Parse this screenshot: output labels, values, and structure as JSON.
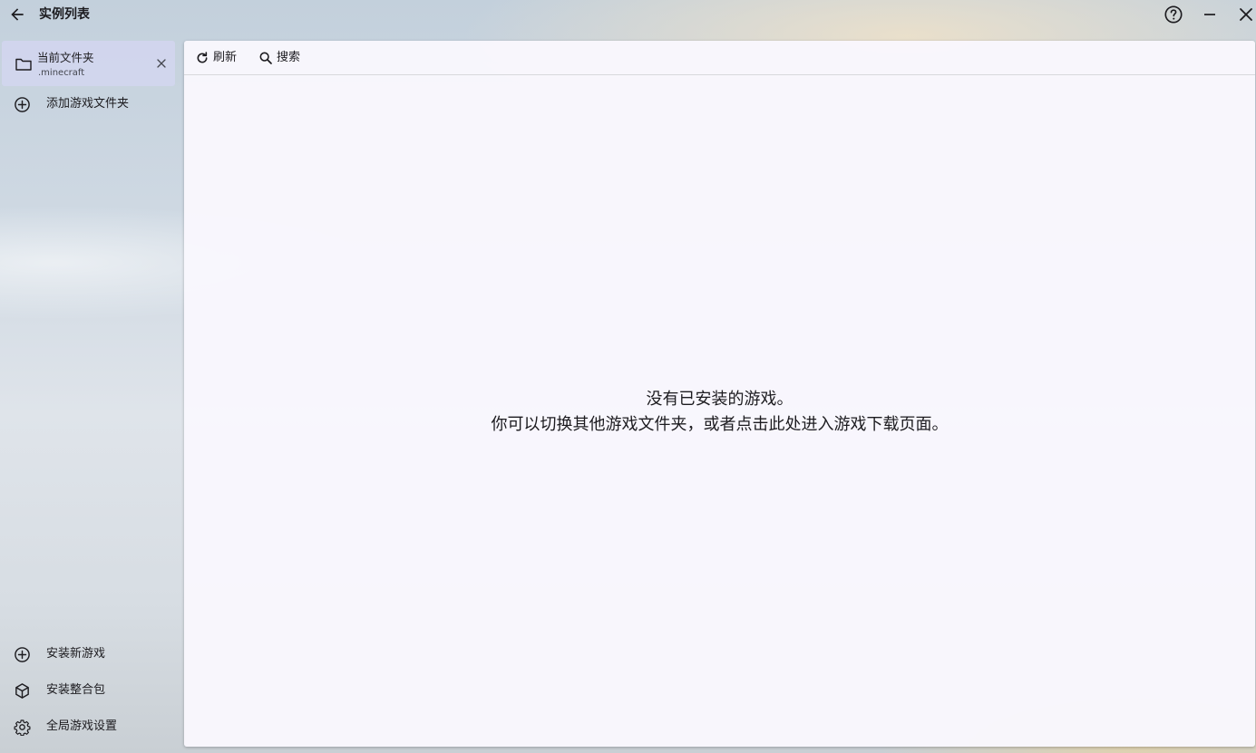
{
  "titlebar": {
    "title": "实例列表",
    "back_icon": "arrow-left-icon",
    "help_icon": "help-circle-icon",
    "minimize_icon": "minimize-icon",
    "close_icon": "close-icon"
  },
  "sidebar": {
    "current_folder": {
      "title": "当前文件夹",
      "subtitle": ".minecraft",
      "icon": "folder-icon",
      "remove_icon": "close-icon"
    },
    "add_folder_label": "添加游戏文件夹",
    "bottom_items": [
      {
        "label": "安装新游戏",
        "icon": "plus-circle-icon"
      },
      {
        "label": "安装整合包",
        "icon": "package-icon"
      },
      {
        "label": "全局游戏设置",
        "icon": "gear-icon"
      }
    ]
  },
  "toolbar": {
    "refresh_label": "刷新",
    "search_label": "搜索"
  },
  "empty_state": {
    "line1": "没有已安装的游戏。",
    "line2": "你可以切换其他游戏文件夹，或者点击此处进入游戏下载页面。"
  },
  "colors": {
    "panel_bg": "#f9f7fd",
    "selected_folder_bg": "#d2d6f0",
    "text": "#1c1b1f"
  }
}
